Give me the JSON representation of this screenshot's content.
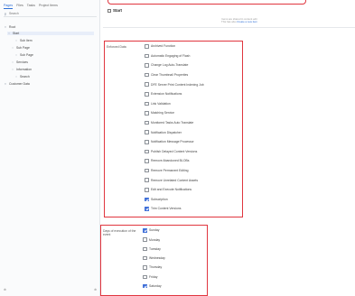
{
  "sidebar": {
    "tabs": [
      {
        "label": "Pages",
        "active": true
      },
      {
        "label": "Files",
        "active": false
      },
      {
        "label": "Tasks",
        "active": false
      },
      {
        "label": "Project Items",
        "active": false
      }
    ],
    "search": {
      "placeholder": "Search"
    },
    "tree": [
      {
        "label": "Root",
        "icon": "folder-icon",
        "selected": false
      },
      {
        "label": "Start",
        "icon": "page-icon",
        "selected": true
      },
      {
        "label": "Sub Item",
        "icon": "page-icon",
        "selected": false
      },
      {
        "label": "Sub Page",
        "icon": "page-icon",
        "selected": false
      },
      {
        "label": "Sub Page",
        "icon": "page-icon",
        "selected": false
      },
      {
        "label": "Services",
        "icon": "page-icon",
        "selected": false
      },
      {
        "label": "Information",
        "icon": "page-icon",
        "selected": false
      },
      {
        "label": "Search",
        "icon": "page-icon",
        "selected": false
      },
      {
        "label": "Customer Data",
        "icon": "folder-icon",
        "selected": false
      }
    ],
    "footer": {
      "left": "⊕",
      "right": "⊕"
    }
  },
  "header": {
    "page_title": "Start"
  },
  "notice": {
    "line1": "Items are shared in content edit",
    "line2": "This has also",
    "link": "Create a new item"
  },
  "field_options": {
    "label": "Enforced Data",
    "options": [
      {
        "label": "Archived Function",
        "checked": false
      },
      {
        "label": "Automatic Engaging of Flash",
        "checked": false
      },
      {
        "label": "Change Log Auto-Translate",
        "checked": false
      },
      {
        "label": "Clear Thumbnail Properties",
        "checked": false
      },
      {
        "label": "DFE Server Print Content Indexing Job",
        "checked": false
      },
      {
        "label": "Extension Notifications",
        "checked": false
      },
      {
        "label": "Link Validation",
        "checked": false
      },
      {
        "label": "Matching Service",
        "checked": false
      },
      {
        "label": "Monitored Tasks Auto Translate",
        "checked": false
      },
      {
        "label": "Notification Dispatcher",
        "checked": false
      },
      {
        "label": "Notification Message Processor",
        "checked": false
      },
      {
        "label": "Publish Delayed Content Versions",
        "checked": false
      },
      {
        "label": "Remove Abandoned BLOBs",
        "checked": false
      },
      {
        "label": "Remove Permanent Editing",
        "checked": false
      },
      {
        "label": "Remove Unrelated Content Assets",
        "checked": false
      },
      {
        "label": "Edit and Execute Notifications",
        "checked": false
      },
      {
        "label": "Subscription",
        "checked": true
      },
      {
        "label": "Trim Content Versions",
        "checked": true
      }
    ]
  },
  "field_days": {
    "label": "Days of execution of the event",
    "options": [
      {
        "label": "Sunday",
        "checked": true
      },
      {
        "label": "Monday",
        "checked": false
      },
      {
        "label": "Tuesday",
        "checked": false
      },
      {
        "label": "Wednesday",
        "checked": false
      },
      {
        "label": "Thursday",
        "checked": false
      },
      {
        "label": "Friday",
        "checked": false
      },
      {
        "label": "Saturday",
        "checked": true
      }
    ]
  }
}
